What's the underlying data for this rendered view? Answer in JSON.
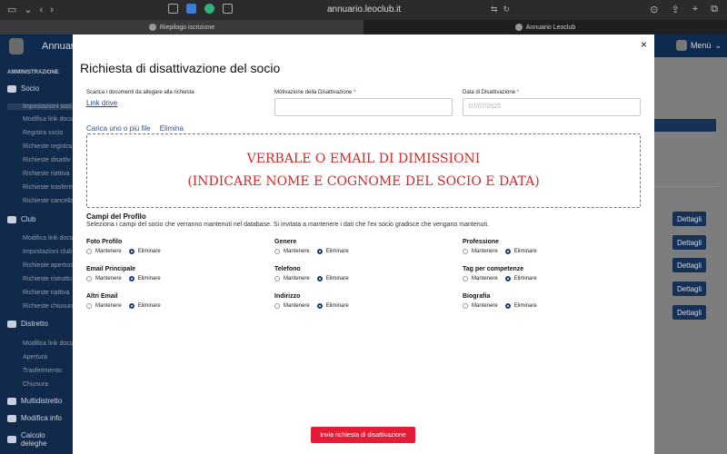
{
  "browser": {
    "url": "annuario.leoclub.it",
    "tabs": [
      {
        "label": "Riepilogo iscrizione"
      },
      {
        "label": "Annuario Leoclub"
      }
    ]
  },
  "app": {
    "title": "Annuari",
    "menu_label": "Menù",
    "sidebar": {
      "section": "AMMINISTRAZIONE",
      "groups": [
        {
          "label": "Socio",
          "items": [
            "Impostazioni soci",
            "Modifica link docu",
            "Registra socio",
            "Richieste registra",
            "Richieste disattiv",
            "Richieste riattiva",
            "Richieste trasferim",
            "Richieste cancella"
          ]
        },
        {
          "label": "Club",
          "items": [
            "Modifica link docu",
            "Impostazioni club",
            "Richieste apertura",
            "Richieste ristruttu",
            "Richieste riattiva",
            "Richieste chiusura"
          ]
        },
        {
          "label": "Distretto",
          "items": [
            "Modifica link docu",
            "Apertura",
            "Trasferimento",
            "Chiusura"
          ]
        }
      ],
      "bottom": [
        "Multidistretto",
        "Modifica info",
        "Calcolo deleghe"
      ]
    },
    "details_label": "Dettagli"
  },
  "modal": {
    "title": "Richiesta di disattivazione del socio",
    "close": "×",
    "docs_label": "Scarica i documenti da allegare alla richiesta",
    "docs_link": "Link drive",
    "motivation_label": "Motivazione della Disattivazione",
    "motivation_value": "",
    "date_label": "Data di Disattivazione",
    "date_value": "07/07/2025",
    "required_mark": "*",
    "upload_link": "Carica uno o più file",
    "delete_link": "Elimina",
    "drop_line1": "VERBALE O EMAIL DI DIMISSIONI",
    "drop_line2": "(INDICARE NOME E COGNOME DEL SOCIO E DATA)",
    "campi_title": "Campi del Profilo",
    "campi_desc": "Seleziona i campi del socio che verranno mantenuti nel database. Si invitata a mantenere i dati che l'ex socio gradisce che vengano mantenuti.",
    "keep_label": "Mantenere",
    "remove_label": "Eliminare",
    "fields": [
      {
        "label": "Foto Profilo",
        "selected": "Eliminare"
      },
      {
        "label": "Genere",
        "selected": "Eliminare"
      },
      {
        "label": "Professione",
        "selected": "Eliminare"
      },
      {
        "label": "Email Principale",
        "selected": "Eliminare"
      },
      {
        "label": "Telefono",
        "selected": "Eliminare"
      },
      {
        "label": "Tag per competenze",
        "selected": "Eliminare"
      },
      {
        "label": "Altri Email",
        "selected": "Eliminare"
      },
      {
        "label": "Indirizzo",
        "selected": "Eliminare"
      },
      {
        "label": "Biografia",
        "selected": "Eliminare"
      }
    ],
    "submit": "Invia richiesta di disattivazione"
  },
  "colors": {
    "sidebar": "#11294a",
    "accent_red": "#e11d38",
    "drop_text": "#d32a2a"
  }
}
